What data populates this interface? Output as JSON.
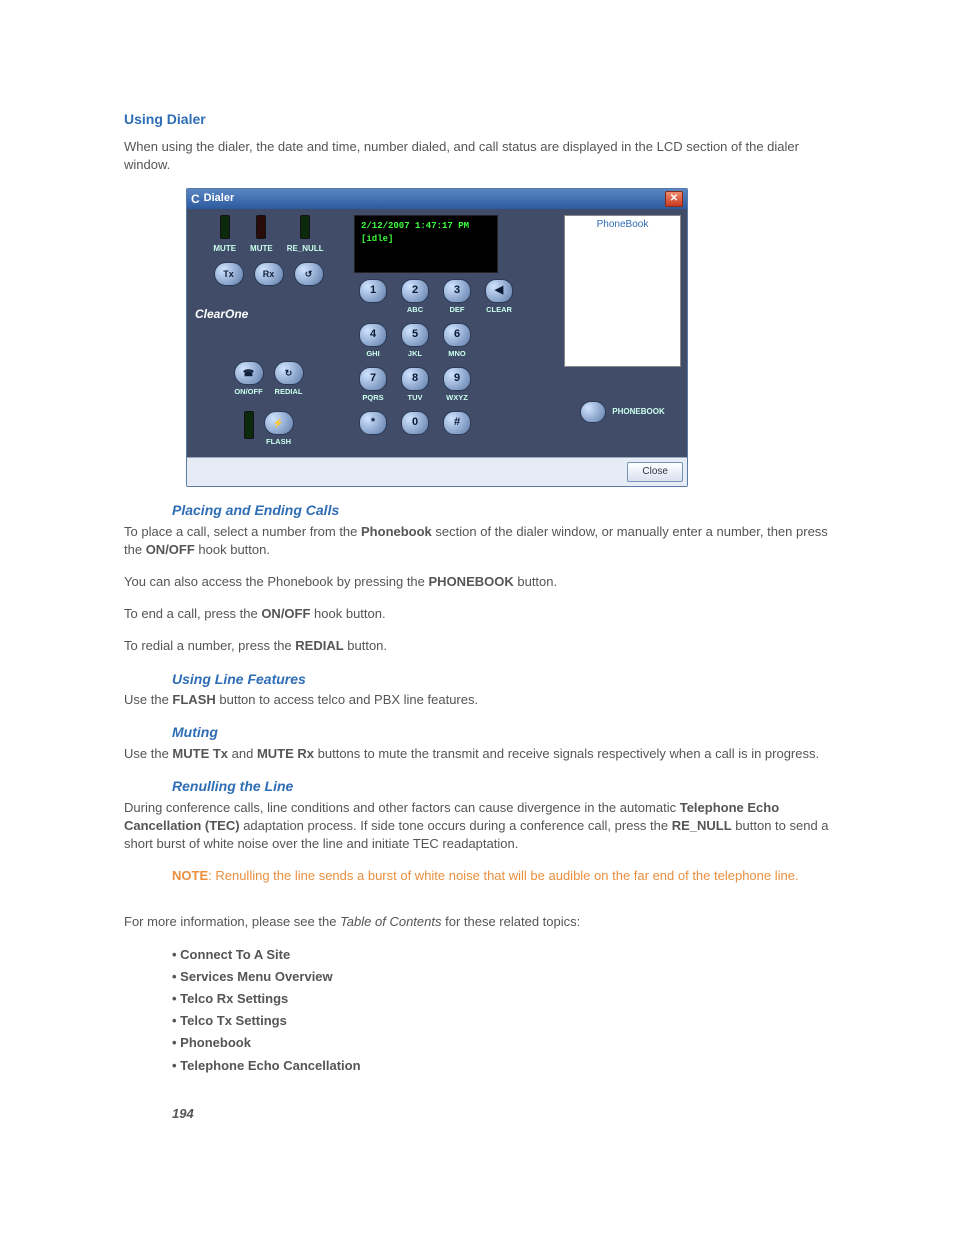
{
  "heading": "Using Dialer",
  "intro": "When using the dialer, the date and time, number dialed, and call status are displayed in the LCD section of the dialer window.",
  "dialer": {
    "title": "Dialer",
    "lcd_line1": "2/12/2007 1:47:17 PM",
    "lcd_line2": "[idle]",
    "leds": [
      "MUTE",
      "MUTE",
      "RE_NULL"
    ],
    "tx_label": "Tx",
    "rx_label": "Rx",
    "brand": "ClearOne",
    "onoff": "ON/OFF",
    "redial": "REDIAL",
    "flash": "FLASH",
    "keypad": [
      {
        "d": "1",
        "l": ""
      },
      {
        "d": "2",
        "l": "ABC"
      },
      {
        "d": "3",
        "l": "DEF"
      },
      {
        "d": "◀",
        "l": "CLEAR"
      },
      {
        "d": "4",
        "l": "GHI"
      },
      {
        "d": "5",
        "l": "JKL"
      },
      {
        "d": "6",
        "l": "MNO"
      },
      {
        "d": "",
        "l": ""
      },
      {
        "d": "7",
        "l": "PQRS"
      },
      {
        "d": "8",
        "l": "TUV"
      },
      {
        "d": "9",
        "l": "WXYZ"
      },
      {
        "d": "",
        "l": ""
      },
      {
        "d": "*",
        "l": ""
      },
      {
        "d": "0",
        "l": ""
      },
      {
        "d": "#",
        "l": ""
      },
      {
        "d": "",
        "l": ""
      }
    ],
    "phonebook_title": "PhoneBook",
    "phonebook_btn": "PHONEBOOK",
    "close": "Close"
  },
  "sections": {
    "placing_h": "Placing and Ending Calls",
    "placing_p1a": "To place a call, select a number from the ",
    "placing_p1b": "Phonebook",
    "placing_p1c": " section of the dialer window, or manually enter a number, then press the ",
    "placing_p1d": "ON/OFF",
    "placing_p1e": " hook button.",
    "placing_p2a": "You can also access the Phonebook by pressing the ",
    "placing_p2b": "PHONEBOOK",
    "placing_p2c": " button.",
    "placing_p3a": "To end a call, press the ",
    "placing_p3b": "ON/OFF",
    "placing_p3c": " hook button.",
    "placing_p4a": "To redial a number, press the ",
    "placing_p4b": "REDIAL",
    "placing_p4c": " button.",
    "line_h": "Using Line Features",
    "line_p1a": "Use the ",
    "line_p1b": "FLASH",
    "line_p1c": " button to access telco and PBX line features.",
    "muting_h": "Muting",
    "muting_p1a": "Use the ",
    "muting_p1b": "MUTE Tx",
    "muting_p1c": " and ",
    "muting_p1d": "MUTE Rx",
    "muting_p1e": " buttons to mute the transmit and receive signals respectively when a call is in progress.",
    "renull_h": "Renulling the Line",
    "renull_p1a": "During conference calls, line conditions and other factors can cause divergence in the automatic ",
    "renull_p1b": "Telephone Echo Cancellation (TEC)",
    "renull_p1c": " adaptation process. If side tone occurs during a conference call, press the ",
    "renull_p1d": "RE_NULL",
    "renull_p1e": " button to send a short burst of white noise over the line and initiate TEC readaptation.",
    "note_label": "NOTE",
    "note_text": ": Renulling the line sends a burst of white noise that will be audible on the far end of the telephone line.",
    "moreinfo_a": "For more information, please see the ",
    "moreinfo_b": "Table of Contents",
    "moreinfo_c": " for these related topics:"
  },
  "topics": [
    "Connect To A Site",
    "Services Menu Overview",
    "Telco Rx Settings",
    "Telco Tx Settings",
    "Phonebook",
    "Telephone Echo Cancellation"
  ],
  "page": "194"
}
